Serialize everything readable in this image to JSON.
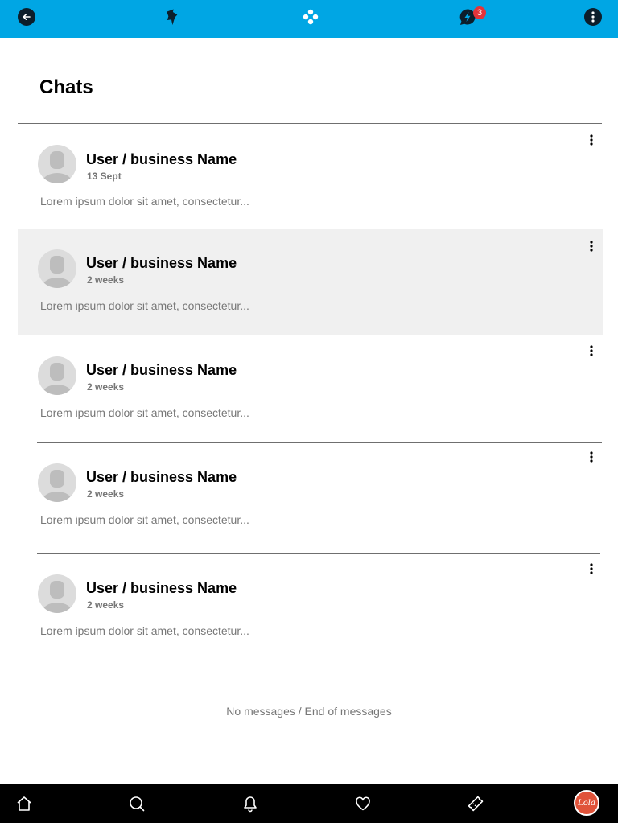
{
  "topbar": {
    "icons": [
      "back-arrow-icon",
      "pin-icon",
      "apps-dots-icon",
      "flash-chat-icon",
      "more-vertical-icon"
    ],
    "notification_count": "3",
    "color": "#00a6e4"
  },
  "header": {
    "title": "Chats"
  },
  "chats": [
    {
      "name": "User / business Name",
      "time": "13 Sept",
      "preview": "Lorem ipsum dolor sit amet, consectetur..."
    },
    {
      "name": "User / business Name",
      "time": "2 weeks",
      "preview": "Lorem ipsum dolor sit amet, consectetur..."
    },
    {
      "name": "User / business Name",
      "time": "2 weeks",
      "preview": "Lorem ipsum dolor sit amet, consectetur..."
    },
    {
      "name": "User / business Name",
      "time": "2 weeks",
      "preview": "Lorem ipsum dolor sit amet, consectetur..."
    },
    {
      "name": "User / business Name",
      "time": "2 weeks",
      "preview": "Lorem ipsum dolor sit amet, consectetur..."
    }
  ],
  "end_message": "No messages / End of messages",
  "bottomnav": {
    "icons": [
      "home-icon",
      "search-icon",
      "bell-icon",
      "heart-icon",
      "ticket-icon"
    ],
    "profile_label": "Lola",
    "profile_color": "#e0533a"
  }
}
